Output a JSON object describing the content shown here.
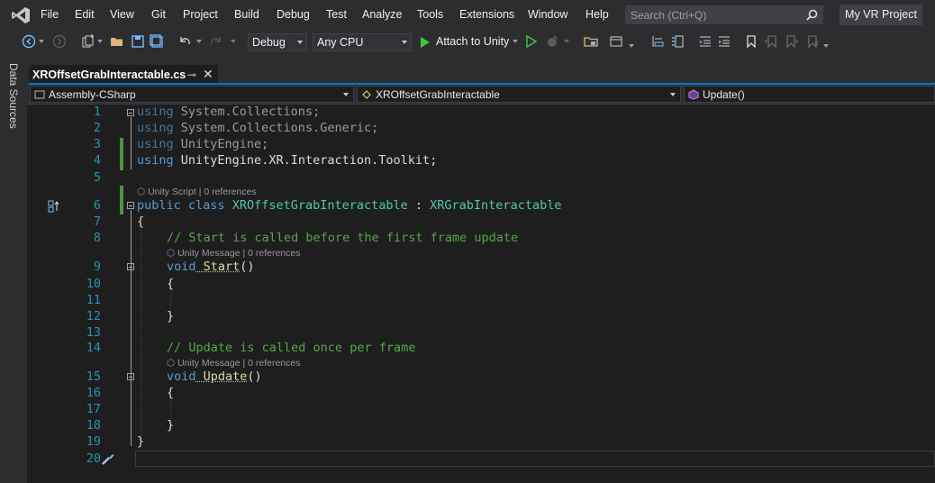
{
  "menubar": {
    "items": [
      "File",
      "Edit",
      "View",
      "Git",
      "Project",
      "Build",
      "Debug",
      "Test",
      "Analyze",
      "Tools",
      "Extensions",
      "Window",
      "Help"
    ],
    "search_placeholder": "Search (Ctrl+Q)",
    "project_name": "My VR Project"
  },
  "toolbar": {
    "config": "Debug",
    "platform": "Any CPU",
    "attach_label": "Attach to Unity"
  },
  "side_panel": {
    "label": "Data Sources"
  },
  "tab": {
    "title": "XROffsetGrabInteractable.cs"
  },
  "navbar": {
    "project": "Assembly-CSharp",
    "class": "XROffsetGrabInteractable",
    "member": "Update()"
  },
  "editor": {
    "line_numbers": [
      "1",
      "2",
      "3",
      "4",
      "5",
      "6",
      "7",
      "8",
      "9",
      "10",
      "11",
      "12",
      "13",
      "14",
      "15",
      "16",
      "17",
      "18",
      "19",
      "20"
    ],
    "lines": {
      "l1_kw": "using",
      "l1_ns": " System.Collections;",
      "l2_kw": "using",
      "l2_ns": " System.Collections.Generic;",
      "l3_kw": "using",
      "l3_ns": " UnityEngine;",
      "l4_kw": "using",
      "l4_a": " UnityEngine",
      "l4_b": ".",
      "l4_c": "XR",
      "l4_d": ".",
      "l4_e": "Interaction",
      "l4_f": ".",
      "l4_g": "Toolkit",
      "l4_h": ";",
      "l6_kw1": "public",
      "l6_kw2": " class",
      "l6_name": " XROffsetGrabInteractable",
      "l6_colon": " :",
      "l6_base": " XRGrabInteractable",
      "l7": "{",
      "l8": "// Start is called before the first frame update",
      "l9_kw": "void",
      "l9_fn": " Start",
      "l9_p": "()",
      "l10": "{",
      "l12": "}",
      "l14": "// Update is called once per frame",
      "l15_kw": "void",
      "l15_fn": " Update",
      "l15_p": "()",
      "l16": "{",
      "l18": "}",
      "l19": "}"
    },
    "codelens": {
      "class": "Unity Script | 0 references",
      "start": "Unity Message | 0 references",
      "update": "Unity Message | 0 references"
    }
  },
  "colors": {
    "keyword": "#569cd6",
    "control_keyword": "#d8a0df",
    "type": "#4ec9b0",
    "comment": "#57a64a",
    "line_number": "#2b91af"
  }
}
